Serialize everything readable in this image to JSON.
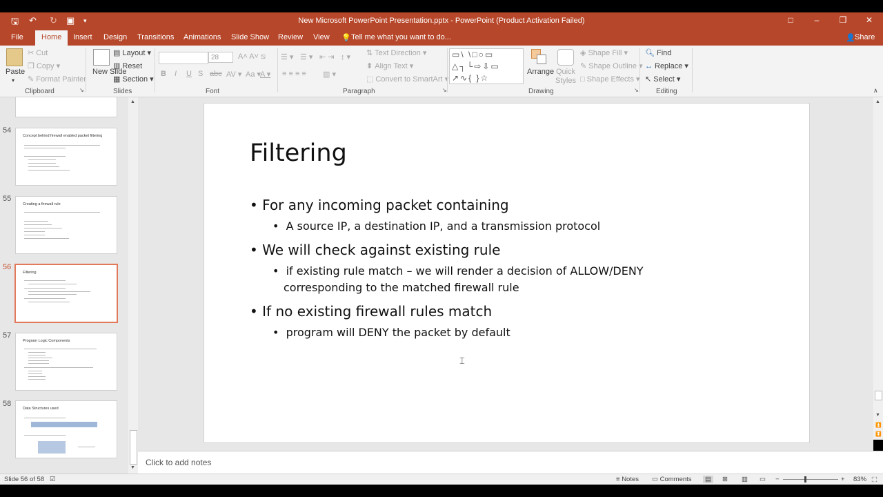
{
  "window": {
    "title": "New Microsoft PowerPoint Presentation.pptx - PowerPoint (Product Activation Failed)"
  },
  "tabs": [
    "File",
    "Home",
    "Insert",
    "Design",
    "Transitions",
    "Animations",
    "Slide Show",
    "Review",
    "View"
  ],
  "tell_me": "Tell me what you want to do...",
  "share": "Share",
  "ribbon": {
    "clipboard": {
      "label": "Clipboard",
      "paste": "Paste",
      "cut": "Cut",
      "copy": "Copy",
      "format_painter": "Format Painter"
    },
    "slides": {
      "label": "Slides",
      "new_slide": "New Slide",
      "layout": "Layout",
      "reset": "Reset",
      "section": "Section"
    },
    "font": {
      "label": "Font",
      "size": "28",
      "bold": "B",
      "italic": "I",
      "underline": "U",
      "shadow": "S",
      "strike": "abc"
    },
    "paragraph": {
      "label": "Paragraph",
      "text_direction": "Text Direction",
      "align_text": "Align Text",
      "smartart": "Convert to SmartArt"
    },
    "drawing": {
      "label": "Drawing",
      "arrange": "Arrange",
      "quick_styles": "Quick Styles",
      "shape_fill": "Shape Fill",
      "shape_outline": "Shape Outline",
      "shape_effects": "Shape Effects"
    },
    "editing": {
      "label": "Editing",
      "find": "Find",
      "replace": "Replace",
      "select": "Select"
    }
  },
  "thumbnails": [
    {
      "num": "54",
      "title": "Concept behind firewall enabled packet filtering"
    },
    {
      "num": "55",
      "title": "Creating a firewall rule"
    },
    {
      "num": "56",
      "title": "Filtering"
    },
    {
      "num": "57",
      "title": "Program Logic Components"
    },
    {
      "num": "58",
      "title": "Data Structures used"
    }
  ],
  "slide": {
    "title": "Filtering",
    "bullets": [
      "For any incoming packet containing",
      "A source IP, a destination IP, and a transmission protocol",
      "We will check against existing rule",
      "if existing rule match – we will render a decision of ALLOW/DENY",
      "corresponding to the matched firewall rule",
      "If no existing firewall rules match",
      "program will DENY the packet by default"
    ]
  },
  "notes_placeholder": "Click to add notes",
  "status": {
    "slide_count": "Slide 56 of 58",
    "notes": "Notes",
    "comments": "Comments",
    "zoom": "83%"
  }
}
